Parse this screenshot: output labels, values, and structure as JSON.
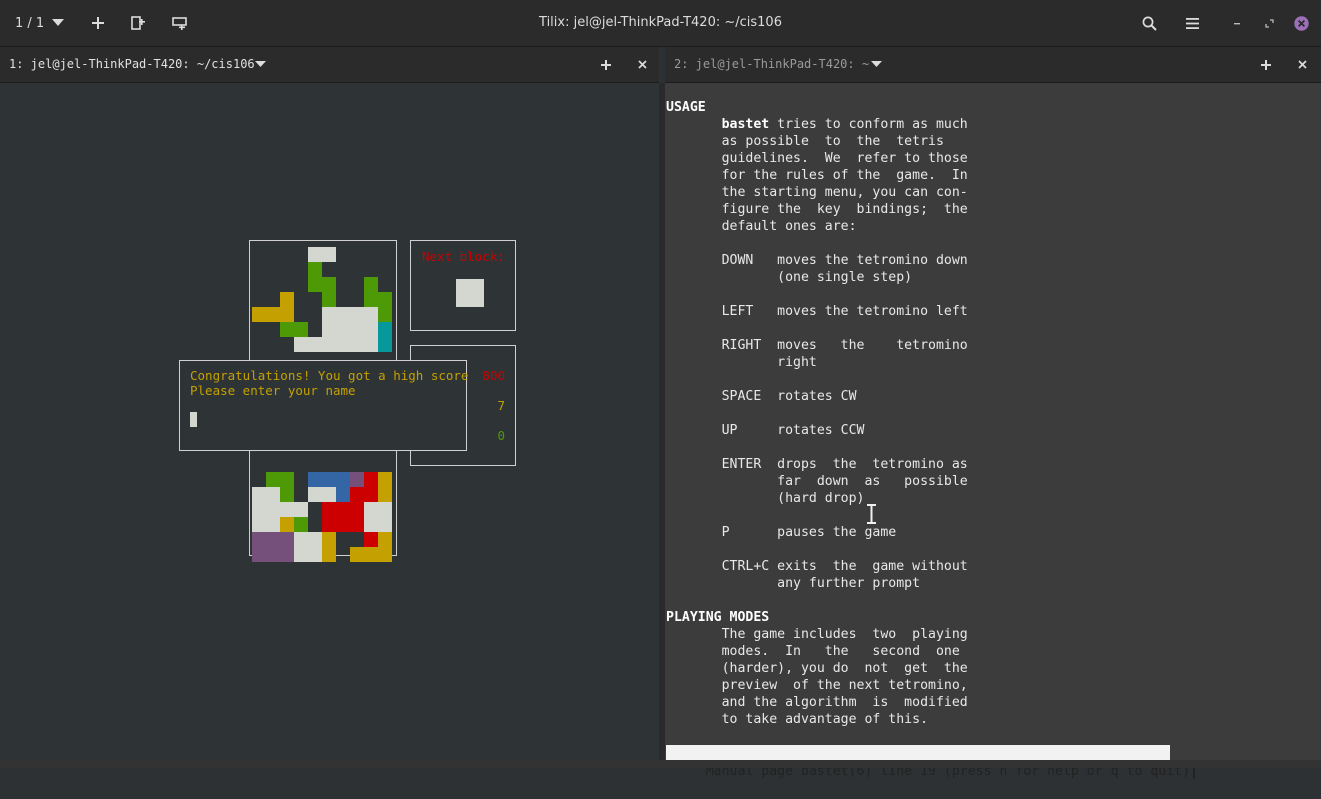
{
  "window": {
    "title": "Tilix: jel@jel-ThinkPad-T420: ~/cis106",
    "session_counter": "1 / 1"
  },
  "panes": [
    {
      "label": "1: jel@jel-ThinkPad-T420: ~/cis106"
    },
    {
      "label": "2: jel@jel-ThinkPad-T420: ~"
    }
  ],
  "game": {
    "next_block_label": "Next block:",
    "score": "800",
    "level": "7",
    "lines": "0",
    "dialog_line1": "Congratulations! You got a high score",
    "dialog_line2": "Please enter your name",
    "colors": {
      "white": "#d3d7cf",
      "green": "#4e9a06",
      "yellow": "#c4a000",
      "red": "#cc0000",
      "blue": "#3465a4",
      "cyan": "#06989a",
      "purple": "#75507b"
    }
  },
  "manpage": {
    "lines": [
      "<b>USAGE</b>",
      "       <b>bastet</b> tries to conform as much",
      "       as possible  to  the  tetris",
      "       guidelines.  We  refer to those",
      "       for the rules of the  game.  In",
      "       the starting menu, you can con-",
      "       figure the  key  bindings;  the",
      "       default ones are:",
      "",
      "       DOWN   moves the tetromino down",
      "              (one single step)",
      "",
      "       LEFT   moves the tetromino left",
      "",
      "       RIGHT  moves   the    tetromino",
      "              right",
      "",
      "       SPACE  rotates CW",
      "",
      "       UP     rotates CCW",
      "",
      "       ENTER  drops  the  tetromino as",
      "              far  down  as   possible",
      "              (hard drop)",
      "",
      "       P      pauses the game",
      "",
      "       CTRL+C exits  the  game without",
      "              any further prompt",
      "",
      "<b>PLAYING MODES</b>",
      "       The game includes  two  playing",
      "       modes.  In   the   second  one",
      "       (harder), you do  not  get  the",
      "       preview  of the next tetromino,",
      "       and the algorithm  is  modified",
      "       to take advantage of this."
    ],
    "status": " Manual page bastet(6) line 19 (press h for help or q to quit)"
  }
}
